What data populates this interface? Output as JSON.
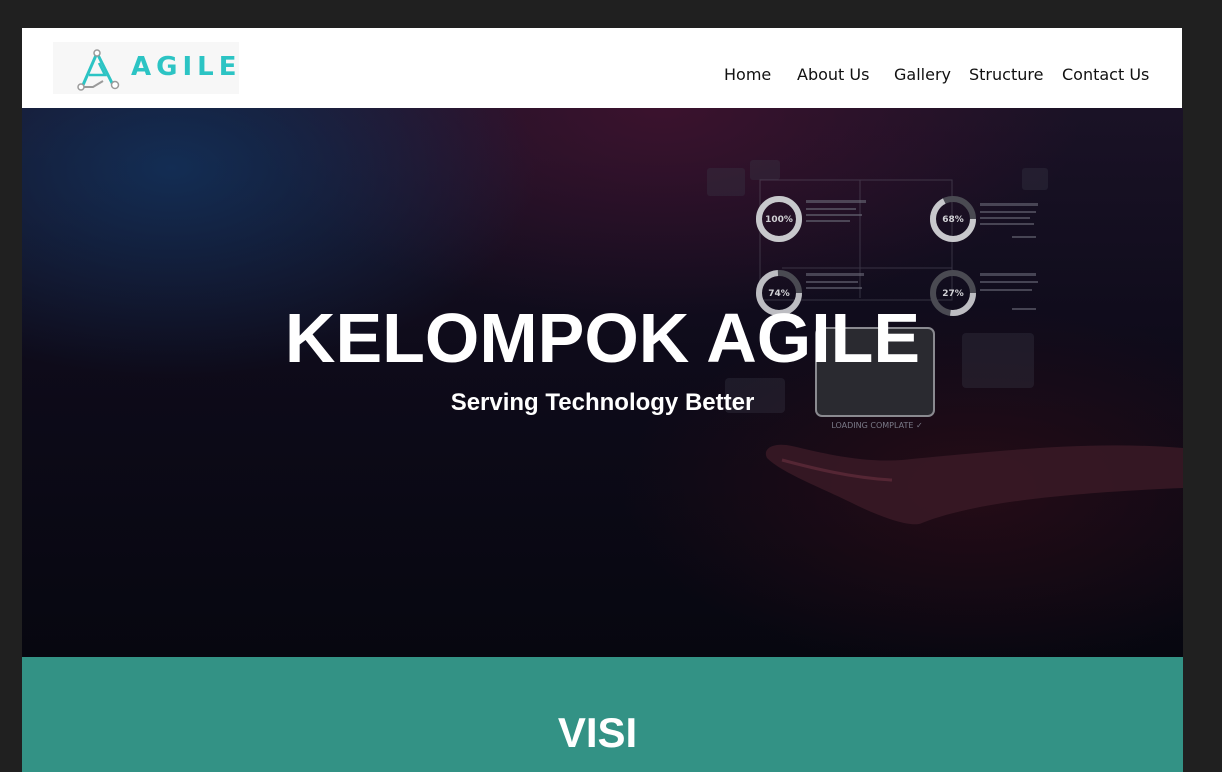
{
  "brand": {
    "name": "AGILE",
    "logo_icon": "agile-logo-icon",
    "accent_color": "#2cc4c4"
  },
  "nav": {
    "items": [
      {
        "label": "Home"
      },
      {
        "label": "About Us"
      },
      {
        "label": "Gallery"
      },
      {
        "label": "Structure"
      },
      {
        "label": "Contact Us"
      }
    ]
  },
  "hero": {
    "title": "KELOMPOK AGILE",
    "subtitle": "Serving Technology Better",
    "dashboard": {
      "gauges": [
        "100%",
        "68%",
        "74%",
        "27%"
      ],
      "status": "LOADING COMPLATE ✓"
    }
  },
  "visi": {
    "title": "VISI",
    "background": "#339285"
  }
}
